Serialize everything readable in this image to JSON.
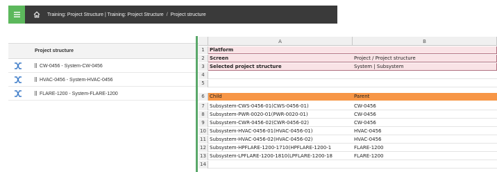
{
  "header": {
    "menu_icon": "hamburger-icon",
    "home_icon": "home-icon",
    "breadcrumb_1": "Training: Project Structure | Training: Project Structure",
    "separator": "/",
    "breadcrumb_2": "Project structure",
    "colors": {
      "bar": "#3a3a3a",
      "menu": "#5cb85c"
    }
  },
  "left_panel": {
    "column_title": "Project structure",
    "rows": [
      {
        "icon": "hierarchy-icon",
        "label": "CW-0456 - System-CW-0456"
      },
      {
        "icon": "hierarchy-icon",
        "label": "HVAC-0456 - System-HVAC-0456"
      },
      {
        "icon": "hierarchy-icon",
        "label": "FLARE-1200 - System-FLARE-1200"
      }
    ]
  },
  "sheet": {
    "columns": [
      "A",
      "B"
    ],
    "rows": [
      {
        "n": "1",
        "a": "Platform",
        "b": ""
      },
      {
        "n": "2",
        "a": "Screen",
        "b": "Project / Project structure"
      },
      {
        "n": "3",
        "a": "Selected project structure",
        "b": "System | Subsystem"
      },
      {
        "n": "4",
        "a": "",
        "b": ""
      },
      {
        "n": "5",
        "a": "",
        "b": ""
      },
      {
        "n": "6",
        "a": "Child",
        "b": "Parent"
      },
      {
        "n": "7",
        "a": "Subsystem-CWS-0456-01(CWS-0456-01)",
        "b": "CW-0456"
      },
      {
        "n": "8",
        "a": "Subsystem-PWR-0020-01(PWR-0020-01)",
        "b": "CW-0456"
      },
      {
        "n": "9",
        "a": "Subsystem-CWR-0456-02(CWR-0456-02)",
        "b": "CW-0456"
      },
      {
        "n": "10",
        "a": "Subsystem-HVAC-0456-01(HVAC-0456-01)",
        "b": "HVAC-0456"
      },
      {
        "n": "11",
        "a": "Subsystem-HVAC-0456-02(HVAC-0456-02)",
        "b": "HVAC-0456"
      },
      {
        "n": "12",
        "a": "Subsystem-HPFLARE-1200-1710(HPFLARE-1200-1",
        "b": "FLARE-1200"
      },
      {
        "n": "13",
        "a": "Subsystem-LPFLARE-1200-1810(LPFLARE-1200-18",
        "b": "FLARE-1200"
      },
      {
        "n": "14",
        "a": "",
        "b": ""
      }
    ],
    "colors": {
      "label_fill": "#f9e3e6",
      "header_fill": "#f79646"
    }
  }
}
